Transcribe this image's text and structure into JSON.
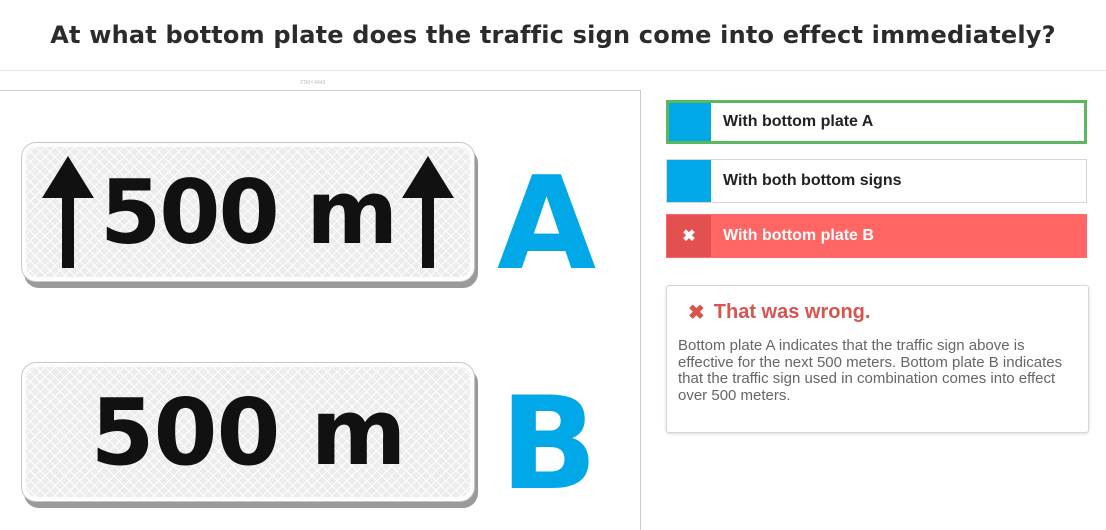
{
  "question": "At what bottom plate does the traffic sign come into effect immediately?",
  "image": {
    "caption_mark": "2TKH 4443",
    "plate_a_text": "500 m",
    "plate_b_text": "500 m",
    "label_a": "A",
    "label_b": "B",
    "label_color": "#00a8e8",
    "arrow_icon": "arrow-up-icon"
  },
  "answers": [
    {
      "label": "With bottom plate A",
      "state": "correct"
    },
    {
      "label": "With both bottom signs",
      "state": "neutral"
    },
    {
      "label": "With bottom plate B",
      "state": "wrong",
      "mark": "✖"
    }
  ],
  "feedback": {
    "icon": "✖",
    "title": "That was wrong.",
    "text": "Bottom plate A indicates that the traffic sign above is effective for the next 500 meters. Bottom plate B indicates that the traffic sign used in combination comes into effect over 500 meters."
  },
  "colors": {
    "accent": "#00a8e8",
    "correct_border": "#5cb85c",
    "wrong_bg": "#ff6664",
    "wrong_text": "#d9534f"
  }
}
